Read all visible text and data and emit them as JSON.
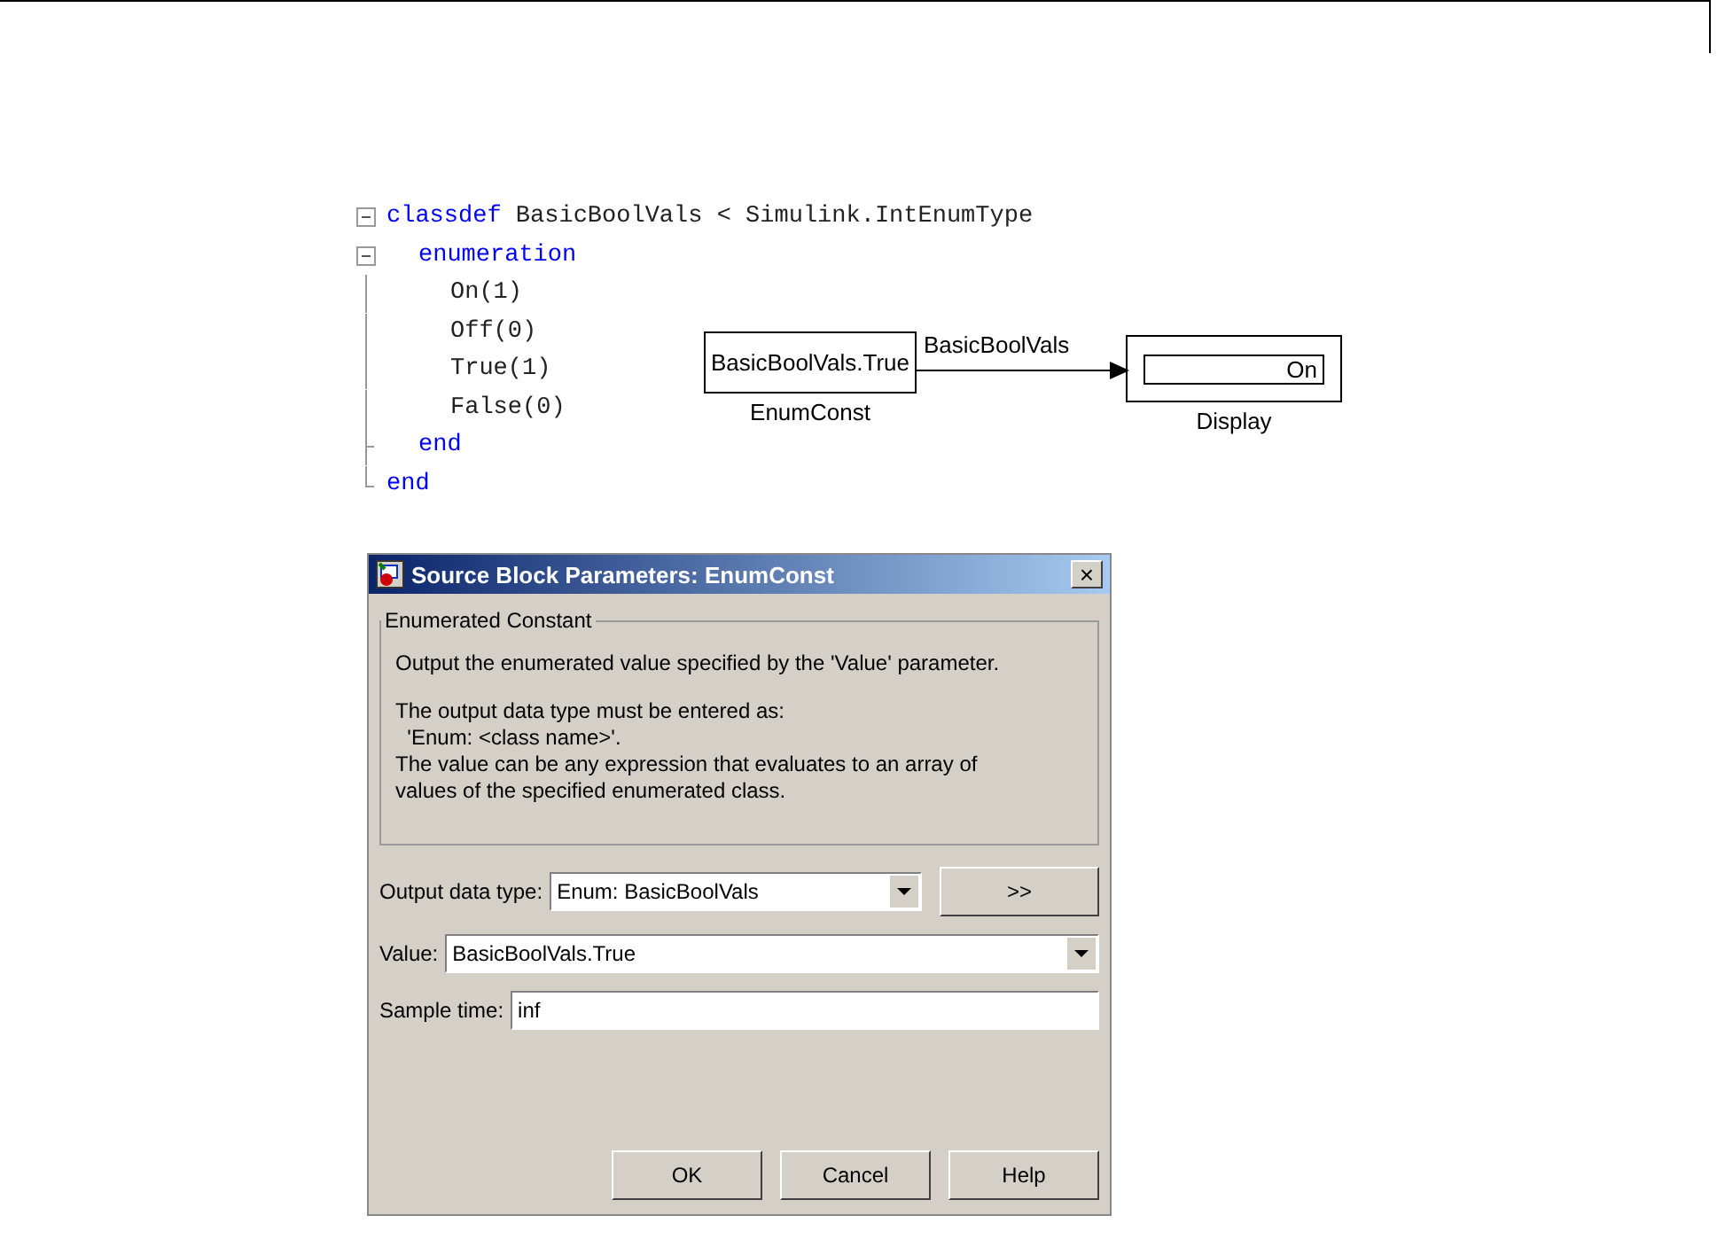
{
  "code": {
    "lines": [
      {
        "segments": [
          {
            "text": "classdef",
            "kind": "keyword"
          },
          {
            "text": " BasicBoolVals < Simulink.IntEnumType",
            "kind": "plain"
          }
        ],
        "children": [
          {
            "segments": [
              {
                "text": "enumeration",
                "kind": "keyword"
              }
            ],
            "children": [
              {
                "segments": [
                  {
                    "text": "On(1)",
                    "kind": "plain"
                  }
                ]
              },
              {
                "segments": [
                  {
                    "text": "Off(0)",
                    "kind": "plain"
                  }
                ]
              },
              {
                "segments": [
                  {
                    "text": "True(1)",
                    "kind": "plain"
                  }
                ]
              },
              {
                "segments": [
                  {
                    "text": "False(0)",
                    "kind": "plain"
                  }
                ]
              }
            ]
          },
          {
            "segments": [
              {
                "text": "end",
                "kind": "keyword"
              }
            ]
          }
        ]
      },
      {
        "segments": [
          {
            "text": "end",
            "kind": "keyword"
          }
        ]
      }
    ]
  },
  "diagram": {
    "source": {
      "value": "BasicBoolVals.True",
      "name": "EnumConst"
    },
    "signal": "BasicBoolVals",
    "display": {
      "value": "On",
      "name": "Display"
    }
  },
  "dialog": {
    "title": "Source Block Parameters: EnumConst",
    "close": "×",
    "group": {
      "title": "Enumerated Constant",
      "paragraphs": [
        "Output the enumerated value specified by the 'Value' parameter.",
        "The output data type must be entered as:\n  'Enum: <class name>'.\nThe value can be any expression that evaluates to an array of\nvalues of the specified enumerated class."
      ]
    },
    "fields": [
      {
        "kind": "dropdown",
        "label": "Output data type:",
        "value": "Enum: BasicBoolVals",
        "button": ">>"
      },
      {
        "kind": "dropdown",
        "label": "Value:",
        "value": "BasicBoolVals.True"
      },
      {
        "kind": "text",
        "label": "Sample time:",
        "value": "inf"
      }
    ],
    "buttons": [
      "OK",
      "Cancel",
      "Help"
    ]
  }
}
